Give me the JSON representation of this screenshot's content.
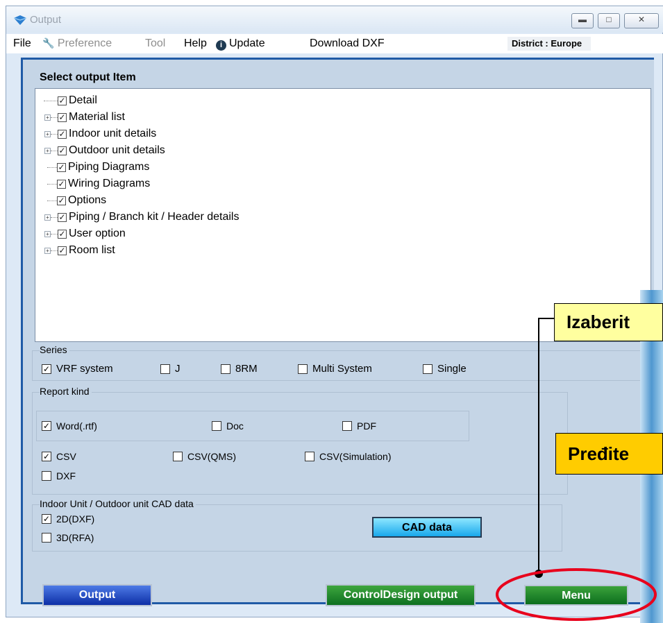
{
  "window": {
    "title": "Output"
  },
  "menubar": {
    "items": [
      {
        "label": "File",
        "disabled": false
      },
      {
        "label": "Preference",
        "disabled": true
      },
      {
        "label": "Tool",
        "disabled": true
      },
      {
        "label": "Help",
        "disabled": false
      },
      {
        "label": "Update",
        "disabled": false
      },
      {
        "label": "Download DXF",
        "disabled": false
      }
    ],
    "district": "District : Europe"
  },
  "select_output": {
    "title": "Select output Item",
    "items": [
      {
        "label": "Detail",
        "expandable": false,
        "checked": true
      },
      {
        "label": "Material list",
        "expandable": true,
        "checked": true
      },
      {
        "label": "Indoor unit details",
        "expandable": true,
        "checked": true
      },
      {
        "label": "Outdoor unit details",
        "expandable": true,
        "checked": true
      },
      {
        "label": "Piping Diagrams",
        "expandable": false,
        "checked": true
      },
      {
        "label": "Wiring Diagrams",
        "expandable": false,
        "checked": true
      },
      {
        "label": "Options",
        "expandable": false,
        "checked": true
      },
      {
        "label": "Piping / Branch kit / Header details",
        "expandable": true,
        "checked": true
      },
      {
        "label": "User option",
        "expandable": true,
        "checked": true
      },
      {
        "label": "Room list",
        "expandable": true,
        "checked": true
      }
    ]
  },
  "series": {
    "title": "Series",
    "options": [
      {
        "label": "VRF system",
        "checked": true
      },
      {
        "label": "J",
        "checked": false
      },
      {
        "label": "8RM",
        "checked": false
      },
      {
        "label": "Multi System",
        "checked": false
      },
      {
        "label": "Single",
        "checked": false
      }
    ]
  },
  "report_kind": {
    "title": "Report kind",
    "word": {
      "label": "Word(.rtf)",
      "checked": true
    },
    "doc": {
      "label": "Doc",
      "checked": false
    },
    "pdf": {
      "label": "PDF",
      "checked": false
    },
    "csv": {
      "label": "CSV",
      "checked": true
    },
    "csv_qms": {
      "label": "CSV(QMS)",
      "checked": false
    },
    "csv_sim": {
      "label": "CSV(Simulation)",
      "checked": false
    },
    "dxf": {
      "label": "DXF",
      "checked": false
    }
  },
  "cad": {
    "title": "Indoor Unit / Outdoor unit CAD data",
    "opt_2d": {
      "label": "2D(DXF)",
      "checked": true
    },
    "opt_3d": {
      "label": "3D(RFA)",
      "checked": false
    },
    "button": "CAD data"
  },
  "buttons": {
    "output": "Output",
    "control_design": "ControlDesign output",
    "menu": "Menu"
  },
  "callouts": {
    "first": "Izaberit",
    "second": "Pređite"
  },
  "colors": {
    "highlight_ellipse": "#e8001c",
    "callout_yellow": "#ffff9f",
    "callout_orange": "#ffcc00",
    "panel_border": "#1f5aa6"
  }
}
